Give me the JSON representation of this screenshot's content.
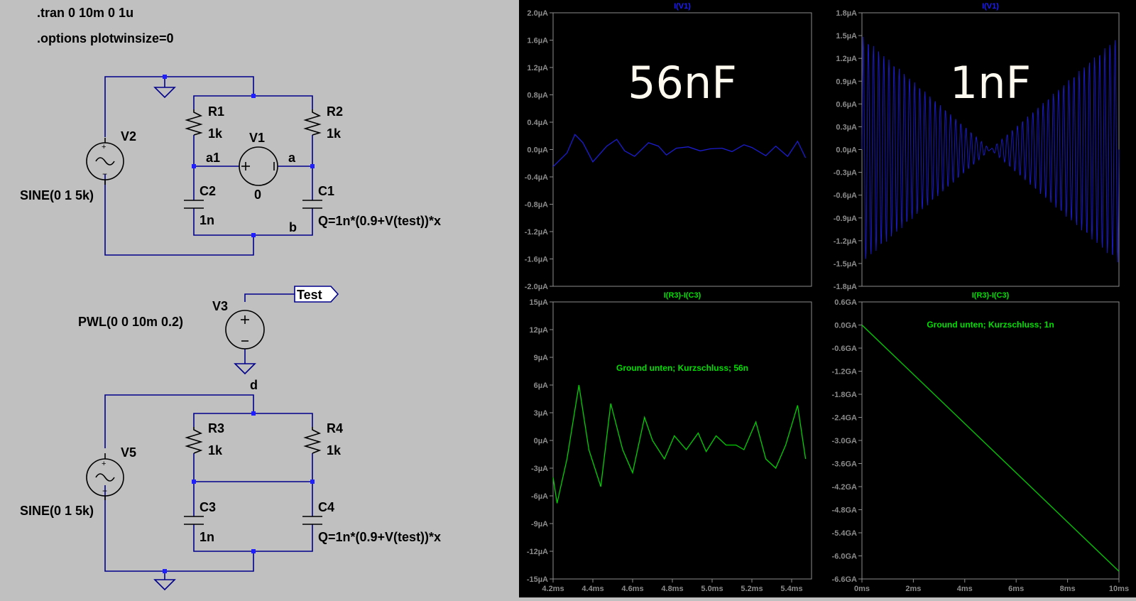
{
  "directives": {
    "tran": ".tran 0 10m 0 1u",
    "options": ".options plotwinsize=0"
  },
  "circuit1": {
    "R1": {
      "name": "R1",
      "value": "1k"
    },
    "R2": {
      "name": "R2",
      "value": "1k"
    },
    "V1": {
      "name": "V1",
      "value": "0"
    },
    "V2": {
      "name": "V2",
      "value": "SINE(0 1 5k)"
    },
    "C1": {
      "name": "C1",
      "value": "Q=1n*(0.9+V(test))*x"
    },
    "C2": {
      "name": "C2",
      "value": "1n"
    },
    "nodes": {
      "a1": "a1",
      "a": "a",
      "b": "b"
    }
  },
  "circuit2": {
    "V3": {
      "name": "V3",
      "value": "PWL(0 0 10m 0.2)"
    },
    "label": "Test",
    "node_d": "d",
    "V5": {
      "name": "V5",
      "value": "SINE(0 1 5k)"
    },
    "R3": {
      "name": "R3",
      "value": "1k"
    },
    "R4": {
      "name": "R4",
      "value": "1k"
    },
    "C3": {
      "name": "C3",
      "value": "1n"
    },
    "C4": {
      "name": "C4",
      "value": "Q=1n*(0.9+V(test))*x"
    }
  },
  "colors": {
    "trace_current": "#1c1cd0",
    "trace_diff": "#00d000",
    "title_current": "#1c1cff",
    "title_diff": "#00e000",
    "axis": "#8c8c8c",
    "overlay": "#fffaf0"
  },
  "plots": {
    "top_left": {
      "title": "I(V1)",
      "overlay": "56nF",
      "yticks": [
        "2.0µA",
        "1.6µA",
        "1.2µA",
        "0.8µA",
        "0.4µA",
        "0.0µA",
        "-0.4µA",
        "-0.8µA",
        "-1.2µA",
        "-1.6µA",
        "-2.0µA"
      ]
    },
    "top_right": {
      "title": "I(V1)",
      "overlay": "1nF",
      "yticks": [
        "1.8µA",
        "1.5µA",
        "1.2µA",
        "0.9µA",
        "0.6µA",
        "0.3µA",
        "0.0µA",
        "-0.3µA",
        "-0.6µA",
        "-0.9µA",
        "-1.2µA",
        "-1.5µA",
        "-1.8µA"
      ]
    },
    "bottom_left": {
      "title": "I(R3)-I(C3)",
      "annotation": "Ground unten; Kurzschluss; 56n",
      "yticks": [
        "15µA",
        "12µA",
        "9µA",
        "6µA",
        "3µA",
        "0µA",
        "-3µA",
        "-6µA",
        "-9µA",
        "-12µA",
        "-15µA"
      ],
      "xticks": [
        "4.2ms",
        "4.4ms",
        "4.6ms",
        "4.8ms",
        "5.0ms",
        "5.2ms",
        "5.4ms"
      ]
    },
    "bottom_right": {
      "title": "I(R3)-I(C3)",
      "annotation": "Ground unten; Kurzschluss; 1n",
      "yticks": [
        "0.6GA",
        "0.0GA",
        "-0.6GA",
        "-1.2GA",
        "-1.8GA",
        "-2.4GA",
        "-3.0GA",
        "-3.6GA",
        "-4.2GA",
        "-4.8GA",
        "-5.4GA",
        "-6.0GA",
        "-6.6GA"
      ],
      "xticks": [
        "0ms",
        "2ms",
        "4ms",
        "6ms",
        "8ms",
        "10ms"
      ]
    }
  },
  "chart_data": [
    {
      "type": "line",
      "title": "I(V1)",
      "x": [
        4.2,
        4.27,
        4.31,
        4.35,
        4.4,
        4.47,
        4.52,
        4.56,
        4.61,
        4.68,
        4.73,
        4.77,
        4.82,
        4.88,
        4.94,
        4.99,
        5.05,
        5.1,
        5.16,
        5.2,
        5.27,
        5.32,
        5.38,
        5.43,
        5.47
      ],
      "series": [
        {
          "values": [
            -0.25,
            -0.05,
            0.22,
            0.1,
            -0.18,
            0.05,
            0.15,
            -0.02,
            -0.1,
            0.1,
            0.05,
            -0.08,
            0.02,
            0.04,
            -0.02,
            0.01,
            0.02,
            -0.03,
            0.07,
            0.03,
            -0.09,
            0.05,
            -0.1,
            0.12,
            -0.12
          ]
        }
      ],
      "ylim": [
        -2.0,
        2.0
      ],
      "xlim": [
        4.2,
        5.5
      ]
    },
    {
      "type": "line",
      "title": "I(V1)",
      "x": [
        0,
        5,
        10
      ],
      "series": [
        {
          "values": [
            1.5,
            0.0,
            1.5
          ]
        }
      ],
      "ylim": [
        -1.8,
        1.8
      ],
      "xlim": [
        0,
        10
      ]
    },
    {
      "type": "line",
      "title": "I(R3)-I(C3)",
      "x": [
        4.2,
        4.22,
        4.27,
        4.33,
        4.38,
        4.44,
        4.49,
        4.55,
        4.6,
        4.66,
        4.7,
        4.76,
        4.81,
        4.87,
        4.93,
        4.97,
        5.02,
        5.07,
        5.12,
        5.16,
        5.22,
        5.27,
        5.32,
        5.37,
        5.43,
        5.47
      ],
      "series": [
        {
          "values": [
            -4,
            -6.8,
            -2,
            6,
            -1,
            -5,
            4,
            -1,
            -3.5,
            2.5,
            0,
            -2,
            0.5,
            -1,
            0.8,
            -1.2,
            0.5,
            -0.5,
            -0.5,
            -1,
            2,
            -2,
            -3,
            -0.5,
            3.8,
            -2
          ]
        }
      ],
      "ylim": [
        -15,
        15
      ],
      "xlim": [
        4.2,
        5.5
      ]
    },
    {
      "type": "line",
      "title": "I(R3)-I(C3)",
      "x": [
        0,
        10
      ],
      "series": [
        {
          "values": [
            0.0,
            -6.4
          ]
        }
      ],
      "ylim": [
        -6.6,
        0.6
      ],
      "xlim": [
        0,
        10
      ]
    }
  ]
}
